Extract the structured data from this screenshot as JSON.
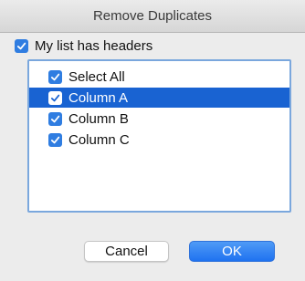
{
  "dialog": {
    "title": "Remove Duplicates"
  },
  "headers_checkbox": {
    "label": "My list has headers",
    "checked": true
  },
  "list": {
    "items": [
      {
        "label": "Select All",
        "checked": true,
        "selected": false
      },
      {
        "label": "Column A",
        "checked": true,
        "selected": true
      },
      {
        "label": "Column B",
        "checked": true,
        "selected": false
      },
      {
        "label": "Column C",
        "checked": true,
        "selected": false
      }
    ]
  },
  "buttons": {
    "cancel_label": "Cancel",
    "ok_label": "OK"
  },
  "colors": {
    "accent": "#2f7de1",
    "selection": "#1963d2",
    "background": "#ececec"
  }
}
